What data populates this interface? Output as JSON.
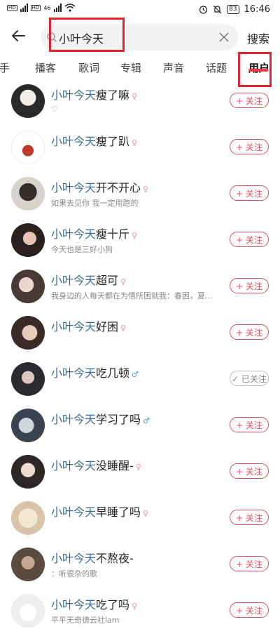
{
  "status": {
    "time": "16:46",
    "battery": "83",
    "net": "46"
  },
  "search": {
    "query": "小叶今天",
    "button": "搜索"
  },
  "tabs": [
    {
      "label": "歌手"
    },
    {
      "label": "播客"
    },
    {
      "label": "歌词"
    },
    {
      "label": "专辑"
    },
    {
      "label": "声音"
    },
    {
      "label": "话题"
    },
    {
      "label": "用户"
    }
  ],
  "active_tab": "用户",
  "colors": {
    "accent": "#e0242f",
    "follow": "#e05060",
    "highlight_name": "#3c6b8e"
  },
  "users": [
    {
      "prefix": "小叶今天",
      "rest": "瘦了嘛",
      "gender": "♀",
      "sub": "♡",
      "follow": "+ 关注"
    },
    {
      "prefix": "小叶今天",
      "rest": "瘦了趴",
      "gender": "♀",
      "sub": "",
      "follow": "+ 关注"
    },
    {
      "prefix": "小叶今天",
      "rest": "开不开心",
      "gender": "♀",
      "sub": "如果去见你 我一定用跑的",
      "follow": "+ 关注"
    },
    {
      "prefix": "小叶今天",
      "rest": "瘦十斤",
      "gender": "♀",
      "sub": "今天也是三好小狗",
      "follow": "+ 关注"
    },
    {
      "prefix": "小叶今天",
      "rest": "超可",
      "gender": "♀",
      "sub": "我身边的人每天都在为情所困就我：春困，夏…",
      "follow": "+ 关注"
    },
    {
      "prefix": "小叶今天",
      "rest": "好困",
      "gender": "♀",
      "sub": "",
      "follow": "+ 关注"
    },
    {
      "prefix": "小叶今天",
      "rest": "吃几顿",
      "gender": "♂",
      "sub": "",
      "follow": "✓ 已关注"
    },
    {
      "prefix": "小叶今天",
      "rest": "学习了吗",
      "gender": "♂",
      "sub": "",
      "follow": "+ 关注"
    },
    {
      "prefix": "小叶今天",
      "rest": "没睡醒-",
      "gender": "♀",
      "sub": "",
      "follow": "+ 关注"
    },
    {
      "prefix": "小叶今天",
      "rest": "早睡了吗",
      "gender": "♀",
      "sub": "",
      "follow": "+ 关注"
    },
    {
      "prefix": "小叶今天",
      "rest": "不熬夜-",
      "gender": "",
      "sub": "：听很杂的歌",
      "follow": "+ 关注"
    },
    {
      "prefix": "小叶今天",
      "rest": "吃了吗",
      "gender": "♀",
      "sub": "平平无奇德云社lam",
      "follow": "+ 关注"
    }
  ]
}
